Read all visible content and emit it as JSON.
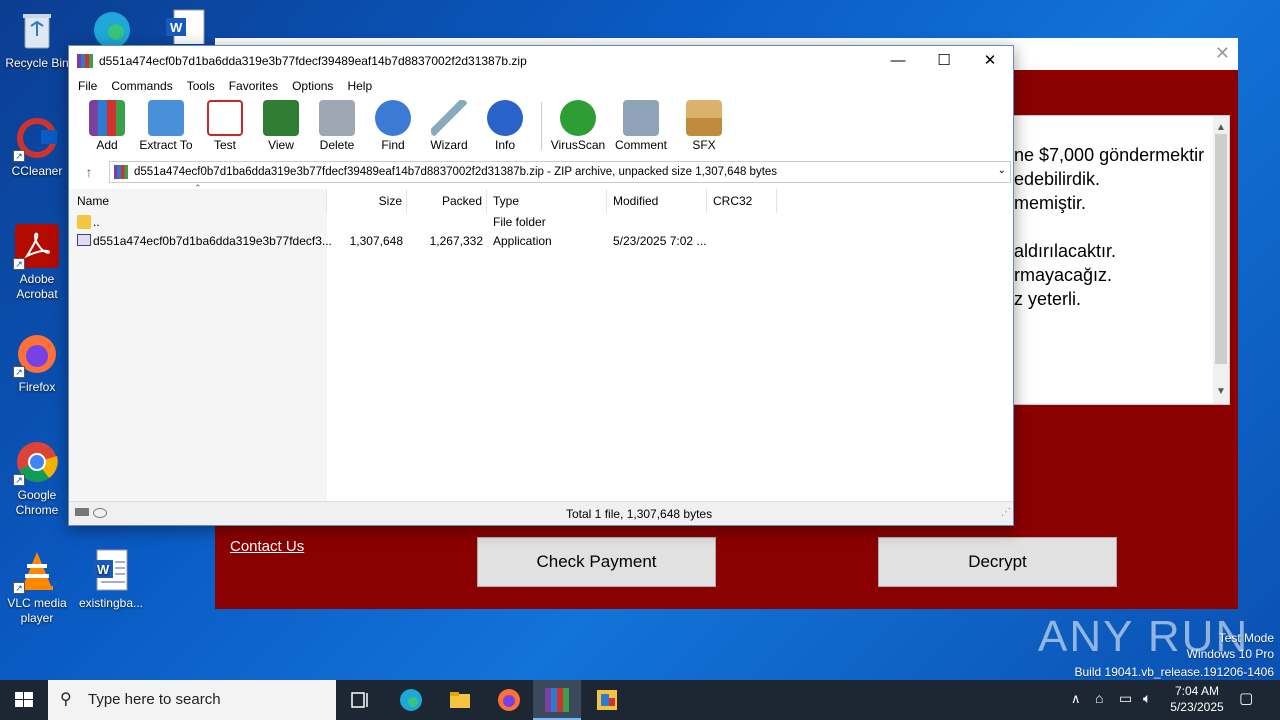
{
  "desktop": {
    "icons": [
      {
        "label": "Recycle Bin"
      },
      {
        "label": "CCleaner"
      },
      {
        "label": "Adobe Acrobat"
      },
      {
        "label": "Firefox"
      },
      {
        "label": "Google Chrome"
      },
      {
        "label": "VLC media player"
      },
      {
        "label": "existingba..."
      }
    ]
  },
  "ransom": {
    "message_lines": [
      "ne $7,000 göndermektir",
      "edebilirdik.",
      "memiştir.",
      "",
      "aldırılacaktır.",
      "rmayacağız.",
      "z yeterli."
    ],
    "contact_label": "Contact Us",
    "check_payment_label": "Check Payment",
    "decrypt_label": "Decrypt",
    "accent_color": "#8b0000"
  },
  "winrar": {
    "title": "d551a474ecf0b7d1ba6dda319e3b77fdecf39489eaf14b7d8837002f2d31387b.zip",
    "menu": [
      "File",
      "Commands",
      "Tools",
      "Favorites",
      "Options",
      "Help"
    ],
    "toolbar": [
      {
        "label": "Add",
        "icon": "add-icon"
      },
      {
        "label": "Extract To",
        "icon": "extract-icon"
      },
      {
        "label": "Test",
        "icon": "test-icon"
      },
      {
        "label": "View",
        "icon": "view-icon"
      },
      {
        "label": "Delete",
        "icon": "delete-icon"
      },
      {
        "label": "Find",
        "icon": "find-icon"
      },
      {
        "label": "Wizard",
        "icon": "wizard-icon"
      },
      {
        "label": "Info",
        "icon": "info-icon"
      },
      {
        "label": "VirusScan",
        "icon": "virusscan-icon"
      },
      {
        "label": "Comment",
        "icon": "comment-icon"
      },
      {
        "label": "SFX",
        "icon": "sfx-icon"
      }
    ],
    "path": "d551a474ecf0b7d1ba6dda319e3b77fdecf39489eaf14b7d8837002f2d31387b.zip - ZIP archive, unpacked size 1,307,648 bytes",
    "columns": [
      "Name",
      "Size",
      "Packed",
      "Type",
      "Modified",
      "CRC32"
    ],
    "rows": [
      {
        "name": "..",
        "size": "",
        "packed": "",
        "type": "File folder",
        "modified": "",
        "crc": ""
      },
      {
        "name": "d551a474ecf0b7d1ba6dda319e3b77fdecf3...",
        "size": "1,307,648",
        "packed": "1,267,332",
        "type": "Application",
        "modified": "5/23/2025 7:02 ...",
        "crc": ""
      }
    ],
    "status": "Total 1 file, 1,307,648 bytes"
  },
  "taskbar": {
    "search_placeholder": "Type here to search",
    "time": "7:04 AM",
    "date": "5/23/2025"
  },
  "watermark": {
    "brand": "ANY RUN",
    "line1": "Test Mode",
    "line2": "Windows 10 Pro",
    "line3": "Build 19041.vb_release.191206-1406"
  }
}
